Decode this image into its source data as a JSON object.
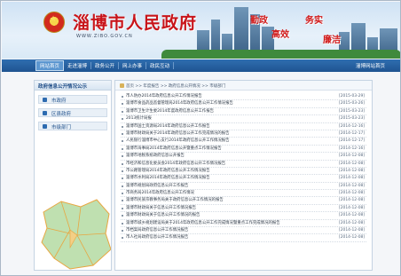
{
  "header": {
    "title": "淄博市人民政府",
    "url": "WWW.ZIBO.GOV.CN",
    "slogans": [
      "勤政",
      "务实",
      "高效",
      "廉洁"
    ]
  },
  "nav": {
    "items": [
      "网站首页",
      "走进淄博",
      "政务公开",
      "网上办事",
      "政民互动"
    ],
    "right": "淄博网站首页"
  },
  "sidebar": {
    "title": "政府信息公开情况公示",
    "items": [
      "市政府",
      "区县政府",
      "市级部门"
    ]
  },
  "breadcrumb": "首页 >> 年度报告 >> 政府信息公开情况 >> 市级部门",
  "list": [
    {
      "title": "市人防办2014年政府信息公开工作情况报告",
      "date": "[2015-03-29]"
    },
    {
      "title": "淄博市食品药品监督管理局2014年政府信息公开工作情况报告",
      "date": "[2015-03-26]"
    },
    {
      "title": "淄博市卫生计生委2014年度政府信息公开工作报告",
      "date": "[2015-03-23]"
    },
    {
      "title": "2013统计局报",
      "date": "[2015-03-23]"
    },
    {
      "title": "淄博市国土资源局2014年政府信息公开工作报告",
      "date": "[2014-12-16]"
    },
    {
      "title": "淄博市财政局关于2014年政府信息公开工作完成情况的报告",
      "date": "[2014-12-17]"
    },
    {
      "title": "人民银行淄博市中心支行2014年政府信息公开工作情况报告",
      "date": "[2014-12-17]"
    },
    {
      "title": "淄博市海事局2014年政府信息公开暨重点工作情况报告",
      "date": "[2014-12-16]"
    },
    {
      "title": "淄博市地税系统政府信息公开报告",
      "date": "[2014-12-08]"
    },
    {
      "title": "市经济和信息化委员会2014年政府信息公开工作情况报告",
      "date": "[2014-12-08]"
    },
    {
      "title": "市公路管理局2014年政府信息公开工作情况报告",
      "date": "[2014-12-08]"
    },
    {
      "title": "淄博市水利局2014年政府信息公开工作情况报告",
      "date": "[2014-12-08]"
    },
    {
      "title": "淄博市规划局政府信息公开工作报告",
      "date": "[2014-12-08]"
    },
    {
      "title": "市商务局2014年政府信息公开工作情况",
      "date": "[2014-12-08]"
    },
    {
      "title": "淄博市民族宗教事务局关于政府信息公开工作情况的报告",
      "date": "[2014-12-08]"
    },
    {
      "title": "淄博市财政局关于信息公开工作情况报告",
      "date": "[2014-12-08]"
    },
    {
      "title": "淄博市财政局关于信息公开工作情况的报告",
      "date": "[2014-12-08]"
    },
    {
      "title": "淄博市城乡规划建设局关于2014年政府信息公开工作完成情况暨重点工作完成情况的报告",
      "date": "[2014-12-08]"
    },
    {
      "title": "市档案局政府信息公开工作情况报告",
      "date": "[2014-12-08]"
    },
    {
      "title": "市人社局政府信息公开工作情况报告",
      "date": "[2014-12-08]"
    }
  ],
  "colors": {
    "nav": "#1f5491",
    "title": "#c8141a",
    "accent": "#2d6bb0"
  }
}
